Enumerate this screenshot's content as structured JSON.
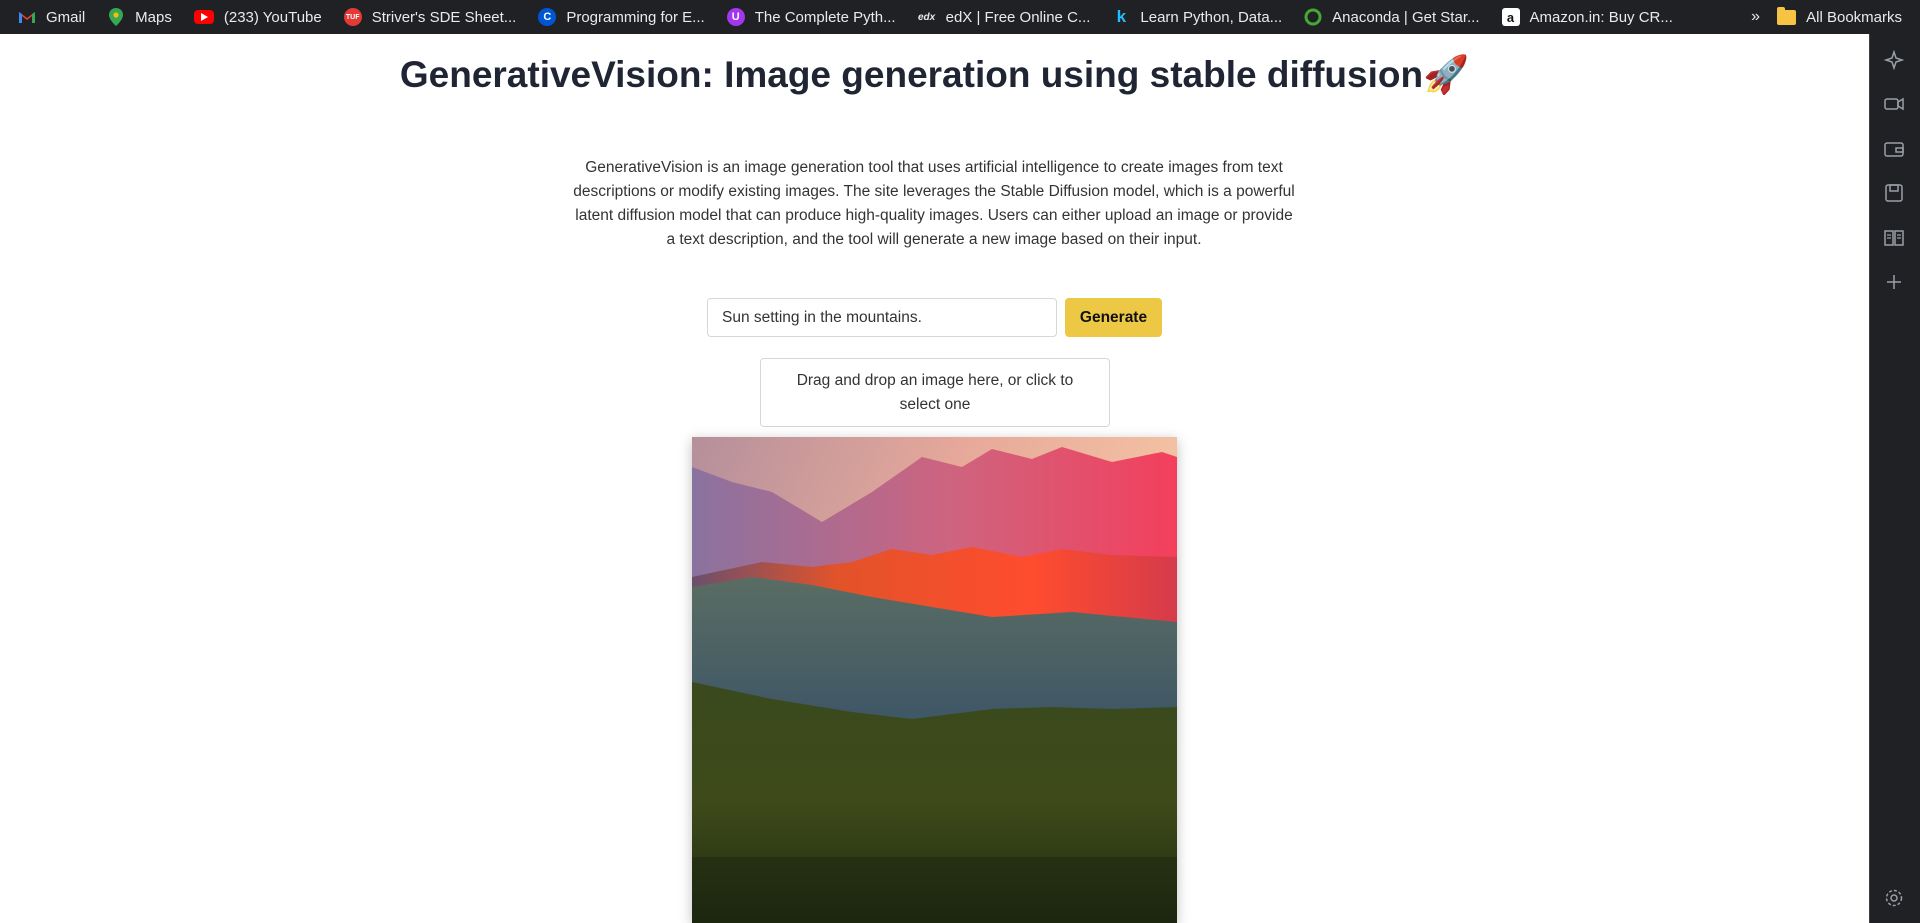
{
  "bookmarks": [
    {
      "label": "Gmail",
      "icon": "gmail-icon"
    },
    {
      "label": "Maps",
      "icon": "maps-icon"
    },
    {
      "label": "(233) YouTube",
      "icon": "youtube-icon"
    },
    {
      "label": "Striver's SDE Sheet...",
      "icon": "tuf-icon"
    },
    {
      "label": "Programming for E...",
      "icon": "coursera-icon"
    },
    {
      "label": "The Complete Pyth...",
      "icon": "udemy-icon"
    },
    {
      "label": "edX | Free Online C...",
      "icon": "edx-icon"
    },
    {
      "label": "Learn Python, Data...",
      "icon": "kaggle-icon"
    },
    {
      "label": "Anaconda | Get Star...",
      "icon": "anaconda-icon"
    },
    {
      "label": "Amazon.in: Buy CR...",
      "icon": "amazon-icon"
    }
  ],
  "bookmarks_more": "»",
  "all_bookmarks": "All Bookmarks",
  "page": {
    "title": "GenerativeVision: Image generation using stable diffusion🚀",
    "description": "GenerativeVision is an image generation tool that uses artificial intelligence to create images from text descriptions or modify existing images. The site leverages the Stable Diffusion model, which is a powerful latent diffusion model that can produce high-quality images. Users can either upload an image or provide a text description, and the tool will generate a new image based on their input.",
    "prompt_value": "Sun setting in the mountains.",
    "generate_label": "Generate",
    "dropzone_text": "Drag and drop an image here, or click to select one"
  },
  "colors": {
    "bookmarks_bg": "#202124",
    "generate_button": "#edc845",
    "title_text": "#1f2533"
  }
}
